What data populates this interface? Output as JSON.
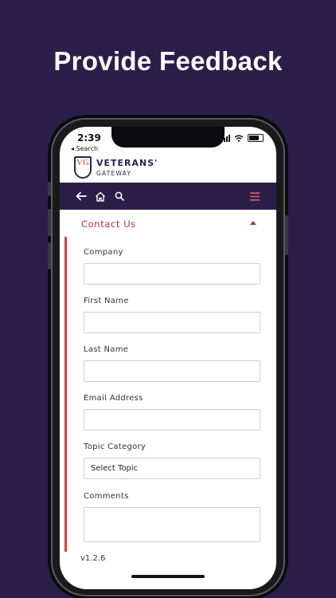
{
  "headline": "Provide Feedback",
  "status": {
    "time": "2:39",
    "back_label": "◂ Search"
  },
  "brand": {
    "name": "VETERANS'",
    "sub": "GATEWAY",
    "logo_text": "VG"
  },
  "nav": {
    "back_icon": "arrow-left-icon",
    "home_icon": "home-icon",
    "search_icon": "search-icon",
    "menu_icon": "hamburger-menu-icon"
  },
  "colors": {
    "background": "#2b1f4a",
    "accent": "#b23434",
    "rule": "#d93d3d",
    "brand_navy": "#2b2550"
  },
  "form": {
    "section_title": "Contact Us",
    "fields": {
      "company": {
        "label": "Company",
        "value": ""
      },
      "first_name": {
        "label": "First Name",
        "value": ""
      },
      "last_name": {
        "label": "Last Name",
        "value": ""
      },
      "email": {
        "label": "Email Address",
        "value": ""
      },
      "topic": {
        "label": "Topic Category",
        "selected": "Select Topic"
      },
      "comments": {
        "label": "Comments",
        "value": ""
      }
    }
  },
  "version": "v1.2.6"
}
